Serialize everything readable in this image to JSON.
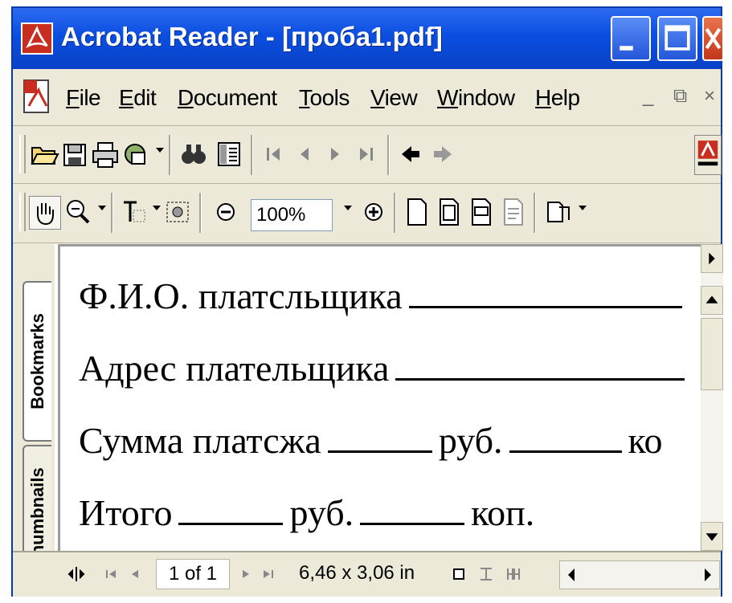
{
  "window": {
    "title": "Acrobat Reader - [проба1.pdf]"
  },
  "menu": {
    "items": [
      "File",
      "Edit",
      "Document",
      "Tools",
      "View",
      "Window",
      "Help"
    ],
    "minimize_glyph": "_",
    "restore_glyph": "⧉",
    "close_glyph": "×"
  },
  "toolbar": {
    "zoom_value": "100%"
  },
  "navigation_tabs": {
    "bookmarks": "Bookmarks",
    "thumbnails": "Thumbnails"
  },
  "document": {
    "lines": [
      {
        "label": "Ф.И.О. платсльщика",
        "suffix": ""
      },
      {
        "label": "Адрес плательщика",
        "suffix": ""
      },
      {
        "label": "Сумма платсжа",
        "mid": "руб.",
        "suffix": "ко"
      },
      {
        "label": "Итого",
        "mid": "руб.",
        "suffix": "коп."
      }
    ]
  },
  "status": {
    "page": "1 of 1",
    "page_size": "6,46 x 3,06 in"
  },
  "colors": {
    "titlebar": "#0a4ee0",
    "close_button": "#c3361b",
    "chrome": "#ece9d8"
  }
}
